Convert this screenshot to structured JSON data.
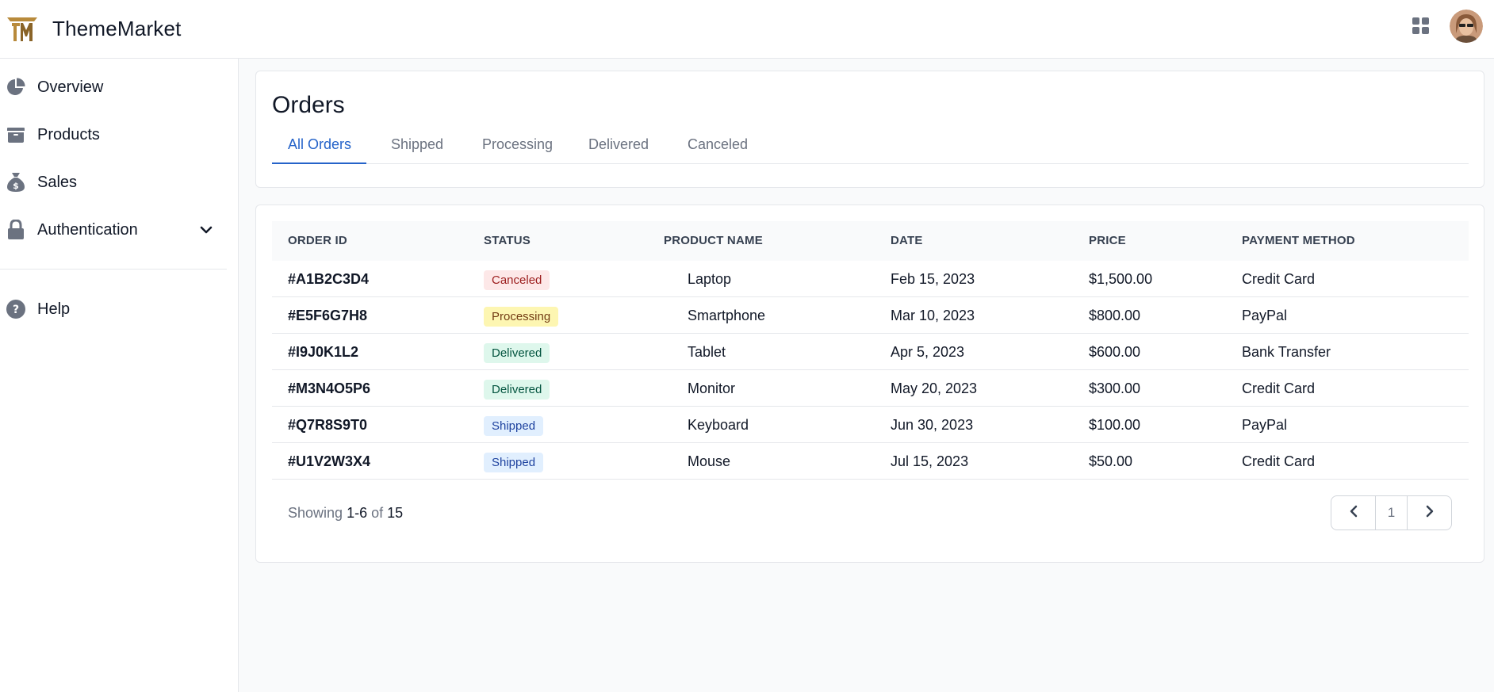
{
  "brand": {
    "name": "ThemeMarket",
    "logo_icon": "tm-logo-icon",
    "logo_color": "#b88a3b"
  },
  "topbar": {
    "apps_icon": "grid-icon",
    "avatar": "user-avatar"
  },
  "sidebar": {
    "items": [
      {
        "label": "Overview",
        "icon": "pie-chart-icon"
      },
      {
        "label": "Products",
        "icon": "box-icon"
      },
      {
        "label": "Sales",
        "icon": "money-bag-icon"
      },
      {
        "label": "Authentication",
        "icon": "lock-icon",
        "expandable": true
      },
      {
        "label": "Help",
        "icon": "question-circle-icon"
      }
    ]
  },
  "page": {
    "title": "Orders",
    "tabs": [
      {
        "label": "All Orders",
        "active": true
      },
      {
        "label": "Shipped",
        "active": false
      },
      {
        "label": "Processing",
        "active": false
      },
      {
        "label": "Delivered",
        "active": false
      },
      {
        "label": "Canceled",
        "active": false
      }
    ]
  },
  "table": {
    "columns": [
      "Order ID",
      "Status",
      "Product Name",
      "Date",
      "Price",
      "Payment Method"
    ],
    "rows": [
      {
        "order_id": "#A1B2C3D4",
        "status": "Canceled",
        "status_kind": "canceled",
        "product": "Laptop",
        "date": "Feb 15, 2023",
        "price": "$1,500.00",
        "payment": "Credit Card"
      },
      {
        "order_id": "#E5F6G7H8",
        "status": "Processing",
        "status_kind": "processing",
        "product": "Smartphone",
        "date": "Mar 10, 2023",
        "price": "$800.00",
        "payment": "PayPal"
      },
      {
        "order_id": "#I9J0K1L2",
        "status": "Delivered",
        "status_kind": "delivered",
        "product": "Tablet",
        "date": "Apr 5, 2023",
        "price": "$600.00",
        "payment": "Bank Transfer"
      },
      {
        "order_id": "#M3N4O5P6",
        "status": "Delivered",
        "status_kind": "delivered",
        "product": "Monitor",
        "date": "May 20, 2023",
        "price": "$300.00",
        "payment": "Credit Card"
      },
      {
        "order_id": "#Q7R8S9T0",
        "status": "Shipped",
        "status_kind": "shipped",
        "product": "Keyboard",
        "date": "Jun 30, 2023",
        "price": "$100.00",
        "payment": "PayPal"
      },
      {
        "order_id": "#U1V2W3X4",
        "status": "Shipped",
        "status_kind": "shipped",
        "product": "Mouse",
        "date": "Jul 15, 2023",
        "price": "$50.00",
        "payment": "Credit Card"
      }
    ]
  },
  "pagination": {
    "showing_prefix": "Showing",
    "range": "1-6",
    "of_label": "of",
    "total": "15",
    "current_page": "1",
    "prev_icon": "chevron-left-icon",
    "next_icon": "chevron-right-icon"
  },
  "colors": {
    "accent": "#2563c9",
    "icon_gray": "#6b7280",
    "canceled_bg": "#fde8e8",
    "processing_bg": "#fdf6b2",
    "delivered_bg": "#def7ec",
    "shipped_bg": "#e1effe"
  }
}
